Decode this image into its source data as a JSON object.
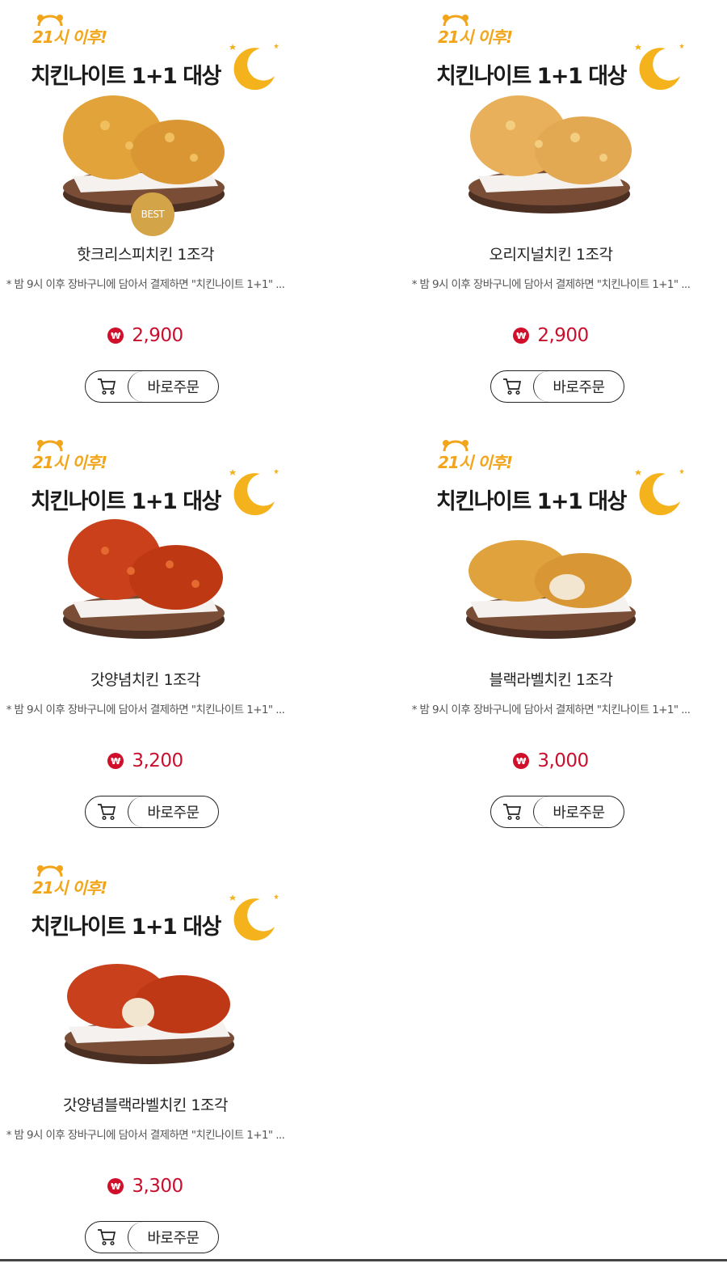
{
  "products": [
    {
      "promo_small": "21시 이후!",
      "promo_big": "치킨나이트 1+1 대상",
      "name": "핫크리스피치킨 1조각",
      "desc": "* 밤 9시 이후 장바구니에 담아서 결제하면 \"치킨나이트 1+1\" ...",
      "price": "2,900",
      "badge": "BEST",
      "order_label": "바로주문",
      "currency_symbol": "₩",
      "image_icon": "hot-crispy-chicken-image",
      "color": "#e2a43a"
    },
    {
      "promo_small": "21시 이후!",
      "promo_big": "치킨나이트 1+1 대상",
      "name": "오리지널치킨 1조각",
      "desc": "* 밤 9시 이후 장바구니에 담아서 결제하면 \"치킨나이트 1+1\" ...",
      "price": "2,900",
      "badge": "",
      "order_label": "바로주문",
      "currency_symbol": "₩",
      "image_icon": "original-chicken-image",
      "color": "#e8b05a"
    },
    {
      "promo_small": "21시 이후!",
      "promo_big": "치킨나이트 1+1 대상",
      "name": "갓양념치킨 1조각",
      "desc": "* 밤 9시 이후 장바구니에 담아서 결제하면 \"치킨나이트 1+1\" ...",
      "price": "3,200",
      "badge": "",
      "order_label": "바로주문",
      "currency_symbol": "₩",
      "image_icon": "seasoned-chicken-image",
      "color": "#c9401a"
    },
    {
      "promo_small": "21시 이후!",
      "promo_big": "치킨나이트 1+1 대상",
      "name": "블랙라벨치킨 1조각",
      "desc": "* 밤 9시 이후 장바구니에 담아서 결제하면 \"치킨나이트 1+1\" ...",
      "price": "3,000",
      "badge": "",
      "order_label": "바로주문",
      "currency_symbol": "₩",
      "image_icon": "black-label-chicken-image",
      "color": "#e0a23c"
    },
    {
      "promo_small": "21시 이후!",
      "promo_big": "치킨나이트 1+1 대상",
      "name": "갓양념블랙라벨치킨 1조각",
      "desc": "* 밤 9시 이후 장바구니에 담아서 결제하면 \"치킨나이트 1+1\" ...",
      "price": "3,300",
      "badge": "",
      "order_label": "바로주문",
      "currency_symbol": "₩",
      "image_icon": "seasoned-black-label-chicken-image",
      "color": "#c8401c"
    }
  ]
}
